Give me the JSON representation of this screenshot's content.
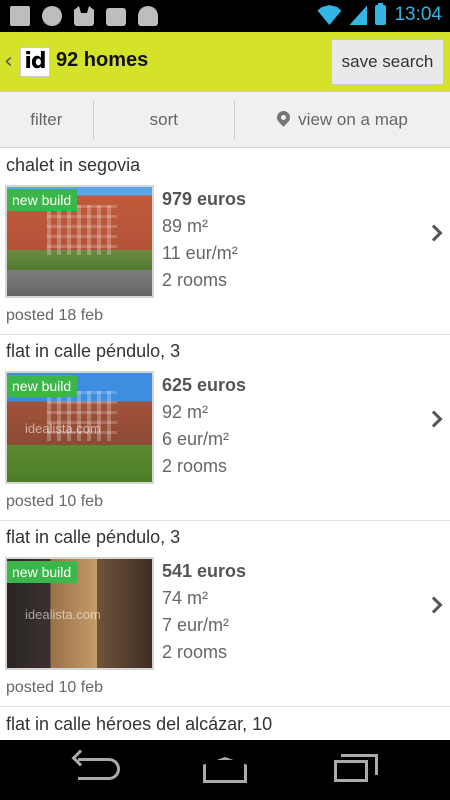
{
  "status_bar": {
    "time": "13:04"
  },
  "action_bar": {
    "logo_text": "id",
    "title": "92 homes",
    "save_search_label": "save search"
  },
  "toolbar": {
    "filter_label": "filter",
    "sort_label": "sort",
    "map_label": "view on a map"
  },
  "listings": [
    {
      "title": "chalet in segovia",
      "badge": "new build",
      "price": "979 euros",
      "area": "89 m²",
      "price_per_m2": "11 eur/m²",
      "rooms": "2 rooms",
      "posted": "posted 18 feb",
      "watermark": ""
    },
    {
      "title": "flat in calle péndulo, 3",
      "badge": "new build",
      "price": "625 euros",
      "area": "92 m²",
      "price_per_m2": "6 eur/m²",
      "rooms": "2 rooms",
      "posted": "posted 10 feb",
      "watermark": "idealista.com"
    },
    {
      "title": "flat in calle péndulo, 3",
      "badge": "new build",
      "price": "541 euros",
      "area": "74 m²",
      "price_per_m2": "7 eur/m²",
      "rooms": "2 rooms",
      "posted": "posted 10 feb",
      "watermark": "idealista.com"
    }
  ],
  "partial_listing": {
    "title": "flat in calle héroes del alcázar, 10"
  },
  "colors": {
    "accent": "#d4e32a",
    "badge": "#3cb54a",
    "status_blue": "#33b5e5"
  },
  "icons": [
    "back-chevron-icon",
    "map-pin-icon",
    "chevron-right-icon",
    "nav-back-icon",
    "nav-home-icon",
    "nav-recent-apps-icon"
  ]
}
